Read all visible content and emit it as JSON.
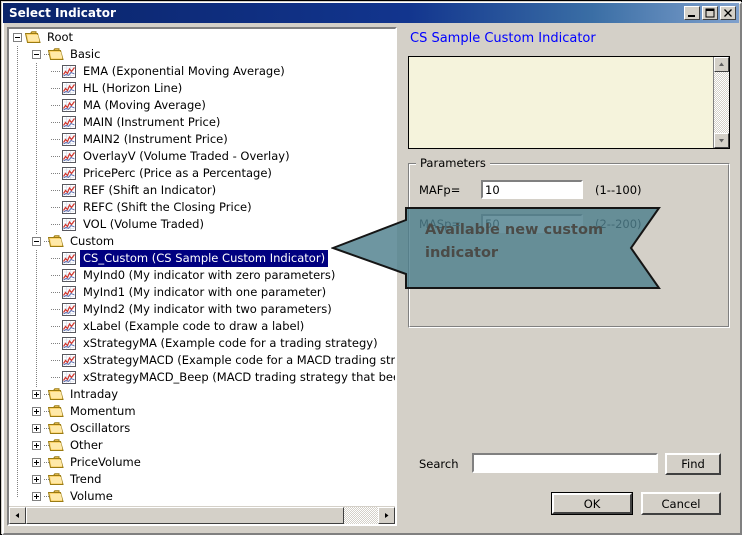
{
  "window": {
    "title": "Select Indicator",
    "buttons": {
      "minimize": "minimize-icon",
      "maximize": "maximize-icon",
      "close": "close-icon"
    }
  },
  "tree": {
    "nodes": [
      {
        "label": "Root",
        "depth": 0,
        "type": "folder",
        "state": "expanded",
        "selected": false
      },
      {
        "label": "Basic",
        "depth": 1,
        "type": "folder",
        "state": "expanded",
        "selected": false
      },
      {
        "label": "EMA (Exponential Moving Average)",
        "depth": 2,
        "type": "indicator",
        "state": "leaf",
        "selected": false
      },
      {
        "label": "HL (Horizon Line)",
        "depth": 2,
        "type": "indicator",
        "state": "leaf",
        "selected": false
      },
      {
        "label": "MA (Moving Average)",
        "depth": 2,
        "type": "indicator",
        "state": "leaf",
        "selected": false
      },
      {
        "label": "MAIN (Instrument Price)",
        "depth": 2,
        "type": "indicator",
        "state": "leaf",
        "selected": false
      },
      {
        "label": "MAIN2 (Instrument Price)",
        "depth": 2,
        "type": "indicator",
        "state": "leaf",
        "selected": false
      },
      {
        "label": "OverlayV (Volume Traded - Overlay)",
        "depth": 2,
        "type": "indicator",
        "state": "leaf",
        "selected": false
      },
      {
        "label": "PricePerc (Price as a Percentage)",
        "depth": 2,
        "type": "indicator",
        "state": "leaf",
        "selected": false
      },
      {
        "label": "REF (Shift an Indicator)",
        "depth": 2,
        "type": "indicator",
        "state": "leaf",
        "selected": false
      },
      {
        "label": "REFC (Shift the Closing Price)",
        "depth": 2,
        "type": "indicator",
        "state": "leaf",
        "selected": false
      },
      {
        "label": "VOL (Volume Traded)",
        "depth": 2,
        "type": "indicator",
        "state": "leaf",
        "selected": false
      },
      {
        "label": "Custom",
        "depth": 1,
        "type": "folder",
        "state": "expanded",
        "selected": false
      },
      {
        "label": "CS_Custom (CS Sample Custom Indicator)",
        "depth": 2,
        "type": "indicator",
        "state": "leaf",
        "selected": true
      },
      {
        "label": "MyInd0 (My indicator with zero parameters)",
        "depth": 2,
        "type": "indicator",
        "state": "leaf",
        "selected": false
      },
      {
        "label": "MyInd1 (My indicator with one parameter)",
        "depth": 2,
        "type": "indicator",
        "state": "leaf",
        "selected": false
      },
      {
        "label": "MyInd2 (My indicator with two parameters)",
        "depth": 2,
        "type": "indicator",
        "state": "leaf",
        "selected": false
      },
      {
        "label": "xLabel (Example code to draw a label)",
        "depth": 2,
        "type": "indicator",
        "state": "leaf",
        "selected": false
      },
      {
        "label": "xStrategyMA (Example code for a trading strategy)",
        "depth": 2,
        "type": "indicator",
        "state": "leaf",
        "selected": false
      },
      {
        "label": "xStrategyMACD (Example code for a MACD trading strategy)",
        "depth": 2,
        "type": "indicator",
        "state": "leaf",
        "selected": false
      },
      {
        "label": "xStrategyMACD_Beep (MACD trading strategy that beeps)",
        "depth": 2,
        "type": "indicator",
        "state": "leaf",
        "selected": false
      },
      {
        "label": "Intraday",
        "depth": 1,
        "type": "folder",
        "state": "collapsed",
        "selected": false
      },
      {
        "label": "Momentum",
        "depth": 1,
        "type": "folder",
        "state": "collapsed",
        "selected": false
      },
      {
        "label": "Oscillators",
        "depth": 1,
        "type": "folder",
        "state": "collapsed",
        "selected": false
      },
      {
        "label": "Other",
        "depth": 1,
        "type": "folder",
        "state": "collapsed",
        "selected": false
      },
      {
        "label": "PriceVolume",
        "depth": 1,
        "type": "folder",
        "state": "collapsed",
        "selected": false
      },
      {
        "label": "Trend",
        "depth": 1,
        "type": "folder",
        "state": "collapsed",
        "selected": false
      },
      {
        "label": "Volume",
        "depth": 1,
        "type": "folder",
        "state": "collapsed",
        "selected": false
      }
    ],
    "hscrollbar": {
      "left_arrow": "arrow-left-icon",
      "right_arrow": "arrow-right-icon"
    }
  },
  "details": {
    "title": "CS Sample Custom Indicator",
    "description": "",
    "scrollbar": {
      "up_arrow": "arrow-up-icon",
      "down_arrow": "arrow-down-icon"
    }
  },
  "parameters": {
    "group_label": "Parameters",
    "rows": [
      {
        "label": "MAFp=",
        "value": "10",
        "range": "(1--100)"
      },
      {
        "label": "MASp=",
        "value": "50",
        "range": "(2--200)"
      }
    ]
  },
  "search": {
    "label": "Search",
    "value": "",
    "find_label": "Find"
  },
  "footer": {
    "ok_label": "OK",
    "cancel_label": "Cancel"
  },
  "callout": {
    "text": "Available new custom indicator",
    "fill": "#4e7f8c",
    "stroke": "#1a1a1a",
    "text_color": "#4b4b47"
  },
  "colors": {
    "title_bar": "#0a246a",
    "dialog_face": "#d4d0c8",
    "selection": "#000080",
    "details_title": "#0000ff",
    "description_bg": "#f5f3dc"
  }
}
